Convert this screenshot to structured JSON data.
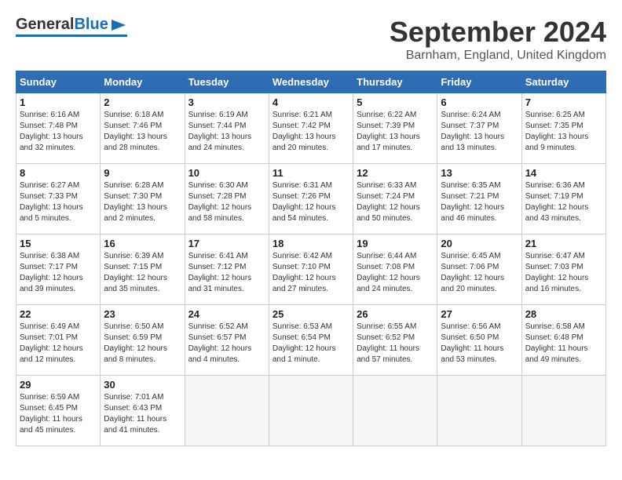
{
  "header": {
    "logo_general": "General",
    "logo_blue": "Blue",
    "title": "September 2024",
    "subtitle": "Barnham, England, United Kingdom"
  },
  "calendar": {
    "days_of_week": [
      "Sunday",
      "Monday",
      "Tuesday",
      "Wednesday",
      "Thursday",
      "Friday",
      "Saturday"
    ],
    "weeks": [
      [
        {
          "day": "",
          "empty": true
        },
        {
          "day": "",
          "empty": true
        },
        {
          "day": "",
          "empty": true
        },
        {
          "day": "",
          "empty": true
        },
        {
          "day": "",
          "empty": true
        },
        {
          "day": "",
          "empty": true
        },
        {
          "day": "",
          "empty": true
        }
      ],
      [
        {
          "day": "1",
          "sunrise": "Sunrise: 6:16 AM",
          "sunset": "Sunset: 7:48 PM",
          "daylight": "Daylight: 13 hours and 32 minutes."
        },
        {
          "day": "2",
          "sunrise": "Sunrise: 6:18 AM",
          "sunset": "Sunset: 7:46 PM",
          "daylight": "Daylight: 13 hours and 28 minutes."
        },
        {
          "day": "3",
          "sunrise": "Sunrise: 6:19 AM",
          "sunset": "Sunset: 7:44 PM",
          "daylight": "Daylight: 13 hours and 24 minutes."
        },
        {
          "day": "4",
          "sunrise": "Sunrise: 6:21 AM",
          "sunset": "Sunset: 7:42 PM",
          "daylight": "Daylight: 13 hours and 20 minutes."
        },
        {
          "day": "5",
          "sunrise": "Sunrise: 6:22 AM",
          "sunset": "Sunset: 7:39 PM",
          "daylight": "Daylight: 13 hours and 17 minutes."
        },
        {
          "day": "6",
          "sunrise": "Sunrise: 6:24 AM",
          "sunset": "Sunset: 7:37 PM",
          "daylight": "Daylight: 13 hours and 13 minutes."
        },
        {
          "day": "7",
          "sunrise": "Sunrise: 6:25 AM",
          "sunset": "Sunset: 7:35 PM",
          "daylight": "Daylight: 13 hours and 9 minutes."
        }
      ],
      [
        {
          "day": "8",
          "sunrise": "Sunrise: 6:27 AM",
          "sunset": "Sunset: 7:33 PM",
          "daylight": "Daylight: 13 hours and 5 minutes."
        },
        {
          "day": "9",
          "sunrise": "Sunrise: 6:28 AM",
          "sunset": "Sunset: 7:30 PM",
          "daylight": "Daylight: 13 hours and 2 minutes."
        },
        {
          "day": "10",
          "sunrise": "Sunrise: 6:30 AM",
          "sunset": "Sunset: 7:28 PM",
          "daylight": "Daylight: 12 hours and 58 minutes."
        },
        {
          "day": "11",
          "sunrise": "Sunrise: 6:31 AM",
          "sunset": "Sunset: 7:26 PM",
          "daylight": "Daylight: 12 hours and 54 minutes."
        },
        {
          "day": "12",
          "sunrise": "Sunrise: 6:33 AM",
          "sunset": "Sunset: 7:24 PM",
          "daylight": "Daylight: 12 hours and 50 minutes."
        },
        {
          "day": "13",
          "sunrise": "Sunrise: 6:35 AM",
          "sunset": "Sunset: 7:21 PM",
          "daylight": "Daylight: 12 hours and 46 minutes."
        },
        {
          "day": "14",
          "sunrise": "Sunrise: 6:36 AM",
          "sunset": "Sunset: 7:19 PM",
          "daylight": "Daylight: 12 hours and 43 minutes."
        }
      ],
      [
        {
          "day": "15",
          "sunrise": "Sunrise: 6:38 AM",
          "sunset": "Sunset: 7:17 PM",
          "daylight": "Daylight: 12 hours and 39 minutes."
        },
        {
          "day": "16",
          "sunrise": "Sunrise: 6:39 AM",
          "sunset": "Sunset: 7:15 PM",
          "daylight": "Daylight: 12 hours and 35 minutes."
        },
        {
          "day": "17",
          "sunrise": "Sunrise: 6:41 AM",
          "sunset": "Sunset: 7:12 PM",
          "daylight": "Daylight: 12 hours and 31 minutes."
        },
        {
          "day": "18",
          "sunrise": "Sunrise: 6:42 AM",
          "sunset": "Sunset: 7:10 PM",
          "daylight": "Daylight: 12 hours and 27 minutes."
        },
        {
          "day": "19",
          "sunrise": "Sunrise: 6:44 AM",
          "sunset": "Sunset: 7:08 PM",
          "daylight": "Daylight: 12 hours and 24 minutes."
        },
        {
          "day": "20",
          "sunrise": "Sunrise: 6:45 AM",
          "sunset": "Sunset: 7:06 PM",
          "daylight": "Daylight: 12 hours and 20 minutes."
        },
        {
          "day": "21",
          "sunrise": "Sunrise: 6:47 AM",
          "sunset": "Sunset: 7:03 PM",
          "daylight": "Daylight: 12 hours and 16 minutes."
        }
      ],
      [
        {
          "day": "22",
          "sunrise": "Sunrise: 6:49 AM",
          "sunset": "Sunset: 7:01 PM",
          "daylight": "Daylight: 12 hours and 12 minutes."
        },
        {
          "day": "23",
          "sunrise": "Sunrise: 6:50 AM",
          "sunset": "Sunset: 6:59 PM",
          "daylight": "Daylight: 12 hours and 8 minutes."
        },
        {
          "day": "24",
          "sunrise": "Sunrise: 6:52 AM",
          "sunset": "Sunset: 6:57 PM",
          "daylight": "Daylight: 12 hours and 4 minutes."
        },
        {
          "day": "25",
          "sunrise": "Sunrise: 6:53 AM",
          "sunset": "Sunset: 6:54 PM",
          "daylight": "Daylight: 12 hours and 1 minute."
        },
        {
          "day": "26",
          "sunrise": "Sunrise: 6:55 AM",
          "sunset": "Sunset: 6:52 PM",
          "daylight": "Daylight: 11 hours and 57 minutes."
        },
        {
          "day": "27",
          "sunrise": "Sunrise: 6:56 AM",
          "sunset": "Sunset: 6:50 PM",
          "daylight": "Daylight: 11 hours and 53 minutes."
        },
        {
          "day": "28",
          "sunrise": "Sunrise: 6:58 AM",
          "sunset": "Sunset: 6:48 PM",
          "daylight": "Daylight: 11 hours and 49 minutes."
        }
      ],
      [
        {
          "day": "29",
          "sunrise": "Sunrise: 6:59 AM",
          "sunset": "Sunset: 6:45 PM",
          "daylight": "Daylight: 11 hours and 45 minutes."
        },
        {
          "day": "30",
          "sunrise": "Sunrise: 7:01 AM",
          "sunset": "Sunset: 6:43 PM",
          "daylight": "Daylight: 11 hours and 41 minutes."
        },
        {
          "day": "",
          "empty": true
        },
        {
          "day": "",
          "empty": true
        },
        {
          "day": "",
          "empty": true
        },
        {
          "day": "",
          "empty": true
        },
        {
          "day": "",
          "empty": true
        }
      ]
    ]
  }
}
